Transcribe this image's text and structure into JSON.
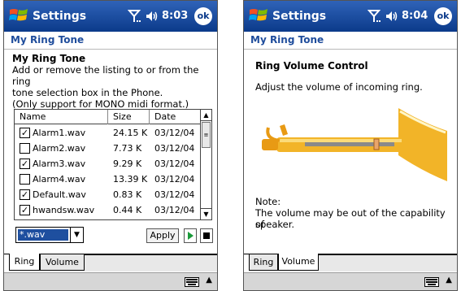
{
  "left": {
    "titlebar": {
      "title": "Settings",
      "time": "8:03",
      "ok": "ok"
    },
    "subheader": "My Ring Tone",
    "heading": "My Ring Tone",
    "description": [
      "Add or remove the listing to or from the ring",
      "tone selection box in the Phone.",
      "(Only support for MONO midi format.)"
    ],
    "table": {
      "headers": [
        "Name",
        "Size",
        "Date"
      ],
      "rows": [
        {
          "checked": true,
          "name": "Alarm1.wav",
          "size": "24.15 K",
          "date": "03/12/04"
        },
        {
          "checked": false,
          "name": "Alarm2.wav",
          "size": "7.73 K",
          "date": "03/12/04"
        },
        {
          "checked": true,
          "name": "Alarm3.wav",
          "size": "9.29 K",
          "date": "03/12/04"
        },
        {
          "checked": false,
          "name": "Alarm4.wav",
          "size": "13.39 K",
          "date": "03/12/04"
        },
        {
          "checked": true,
          "name": "Default.wav",
          "size": "0.83 K",
          "date": "03/12/04"
        },
        {
          "checked": true,
          "name": "hwandsw.wav",
          "size": "0.44 K",
          "date": "03/12/04"
        }
      ]
    },
    "filter": "*.wav",
    "apply": "Apply",
    "tabs": [
      "Ring",
      "Volume"
    ],
    "active_tab": 0
  },
  "right": {
    "titlebar": {
      "title": "Settings",
      "time": "8:04",
      "ok": "ok"
    },
    "subheader": "My Ring Tone",
    "heading": "Ring Volume Control",
    "description": "Adjust the volume of incoming ring.",
    "volume_level": 0.8,
    "note_label": "Note:",
    "note_lines": [
      "The volume may be out of the capability of",
      "speaker."
    ],
    "tabs": [
      "Ring",
      "Volume"
    ],
    "active_tab": 1
  },
  "colors": {
    "titlebar": "#0b3a8a",
    "accent": "#1f4d9c",
    "trumpet": "#f2b428"
  },
  "icons": [
    "windows-flag-icon",
    "signal-icon",
    "speaker-volume-icon",
    "keyboard-icon",
    "play-icon",
    "stop-icon"
  ]
}
